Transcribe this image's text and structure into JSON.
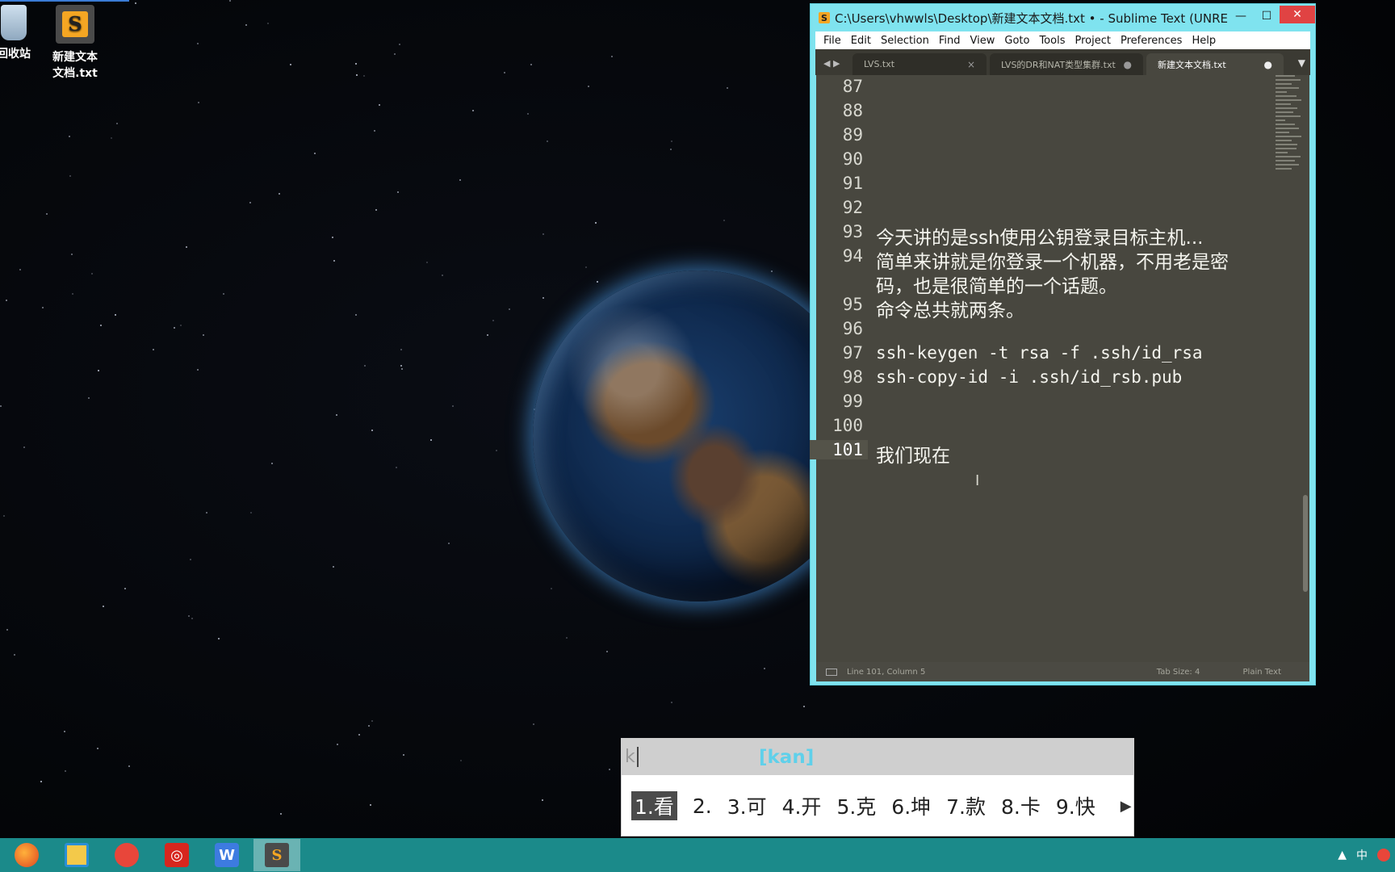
{
  "desktop": {
    "icons": [
      {
        "label": "回收站"
      },
      {
        "label": "新建文本\n文档.txt",
        "label_line1": "新建文本",
        "label_line2": "文档.txt"
      }
    ]
  },
  "window": {
    "title": "C:\\Users\\vhwwls\\Desktop\\新建文本文档.txt • - Sublime Text (UNRE...",
    "controls": {
      "minimize": "—",
      "maximize": "☐",
      "close": "✕"
    },
    "menu": [
      "File",
      "Edit",
      "Selection",
      "Find",
      "View",
      "Goto",
      "Tools",
      "Project",
      "Preferences",
      "Help"
    ],
    "tabs": [
      {
        "label": "LVS.txt",
        "mark": "×"
      },
      {
        "label": "LVS的DR和NAT类型集群.txt",
        "mark": "●"
      },
      {
        "label": "新建文本文档.txt",
        "mark": "●",
        "active": true
      }
    ],
    "editor": {
      "lines": [
        {
          "n": "87",
          "text": ""
        },
        {
          "n": "88",
          "text": ""
        },
        {
          "n": "89",
          "text": ""
        },
        {
          "n": "90",
          "text": ""
        },
        {
          "n": "91",
          "text": ""
        },
        {
          "n": "92",
          "text": ""
        },
        {
          "n": "93",
          "text": "今天讲的是ssh使用公钥登录目标主机..."
        },
        {
          "n": "94",
          "text": "简单来讲就是你登录一个机器，不用老是密",
          "wrap": "码，也是很简单的一个话题。"
        },
        {
          "n": "95",
          "text": "命令总共就两条。"
        },
        {
          "n": "96",
          "text": ""
        },
        {
          "n": "97",
          "text": "ssh-keygen -t rsa -f .ssh/id_rsa"
        },
        {
          "n": "98",
          "text": "ssh-copy-id -i .ssh/id_rsb.pub"
        },
        {
          "n": "99",
          "text": ""
        },
        {
          "n": "100",
          "text": ""
        },
        {
          "n": "101",
          "text": "我们现在",
          "current": true
        }
      ]
    },
    "status": {
      "position": "Line 101, Column 5",
      "tab_size": "Tab Size: 4",
      "syntax": "Plain Text"
    }
  },
  "ime": {
    "input": "k",
    "pinyin": "[kan]",
    "candidates": [
      "1.看",
      "2.",
      "3.可",
      "4.开",
      "5.克",
      "6.坤",
      "7.款",
      "8.卡",
      "9.快"
    ],
    "next_icon": "arrow-right"
  },
  "taskbar": {
    "items": [
      "firefox",
      "file-manager",
      "app-red-fish",
      "netease-music",
      "wps-writer",
      "sublime-text"
    ],
    "tray": {
      "ime_indicator": "中"
    }
  },
  "colors": {
    "window_border": "#7fe3ef",
    "editor_bg": "#48473f",
    "taskbar": "#1b8a8a",
    "close_button": "#e04343"
  }
}
